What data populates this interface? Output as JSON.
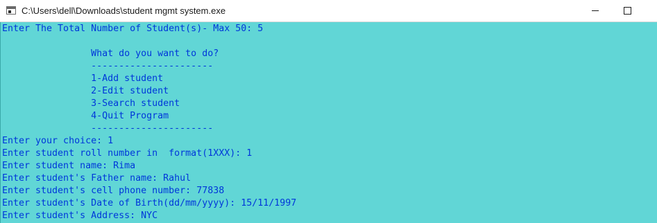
{
  "window": {
    "title": "C:\\Users\\dell\\Downloads\\student mgmt system.exe"
  },
  "icons": {
    "app": "console-app-icon",
    "minimize": "minimize-icon",
    "maximize": "maximize-icon"
  },
  "colors": {
    "console_background": "#61d6d6",
    "console_text": "#0037da"
  },
  "console": {
    "lines": [
      "Enter The Total Number of Student(s)- Max 50: 5",
      "",
      "                What do you want to do?",
      "                ----------------------",
      "                1-Add student",
      "                2-Edit student",
      "                3-Search student",
      "                4-Quit Program",
      "                ----------------------",
      "Enter your choice: 1",
      "Enter student roll number in  format(1XXX): 1",
      "Enter student name: Rima",
      "Enter student's Father name: Rahul",
      "Enter student's cell phone number: 77838",
      "Enter student's Date of Birth(dd/mm/yyyy): 15/11/1997",
      "Enter student's Address: NYC"
    ]
  }
}
